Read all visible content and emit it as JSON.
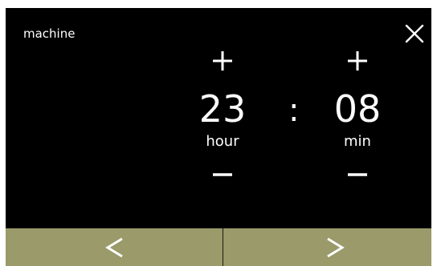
{
  "header": {
    "title": "machine",
    "close_icon": "close-icon"
  },
  "time_picker": {
    "hour": {
      "value": "23",
      "unit": "hour",
      "increment_icon": "plus-icon",
      "decrement_icon": "minus-icon"
    },
    "separator": ":",
    "minute": {
      "value": "08",
      "unit": "min",
      "increment_icon": "plus-icon",
      "decrement_icon": "minus-icon"
    }
  },
  "navigation": {
    "prev_icon": "chevron-left-icon",
    "next_icon": "chevron-right-icon"
  },
  "colors": {
    "screen_background": "#000000",
    "text": "#ffffff",
    "nav_bar": "#9a9a6a"
  }
}
